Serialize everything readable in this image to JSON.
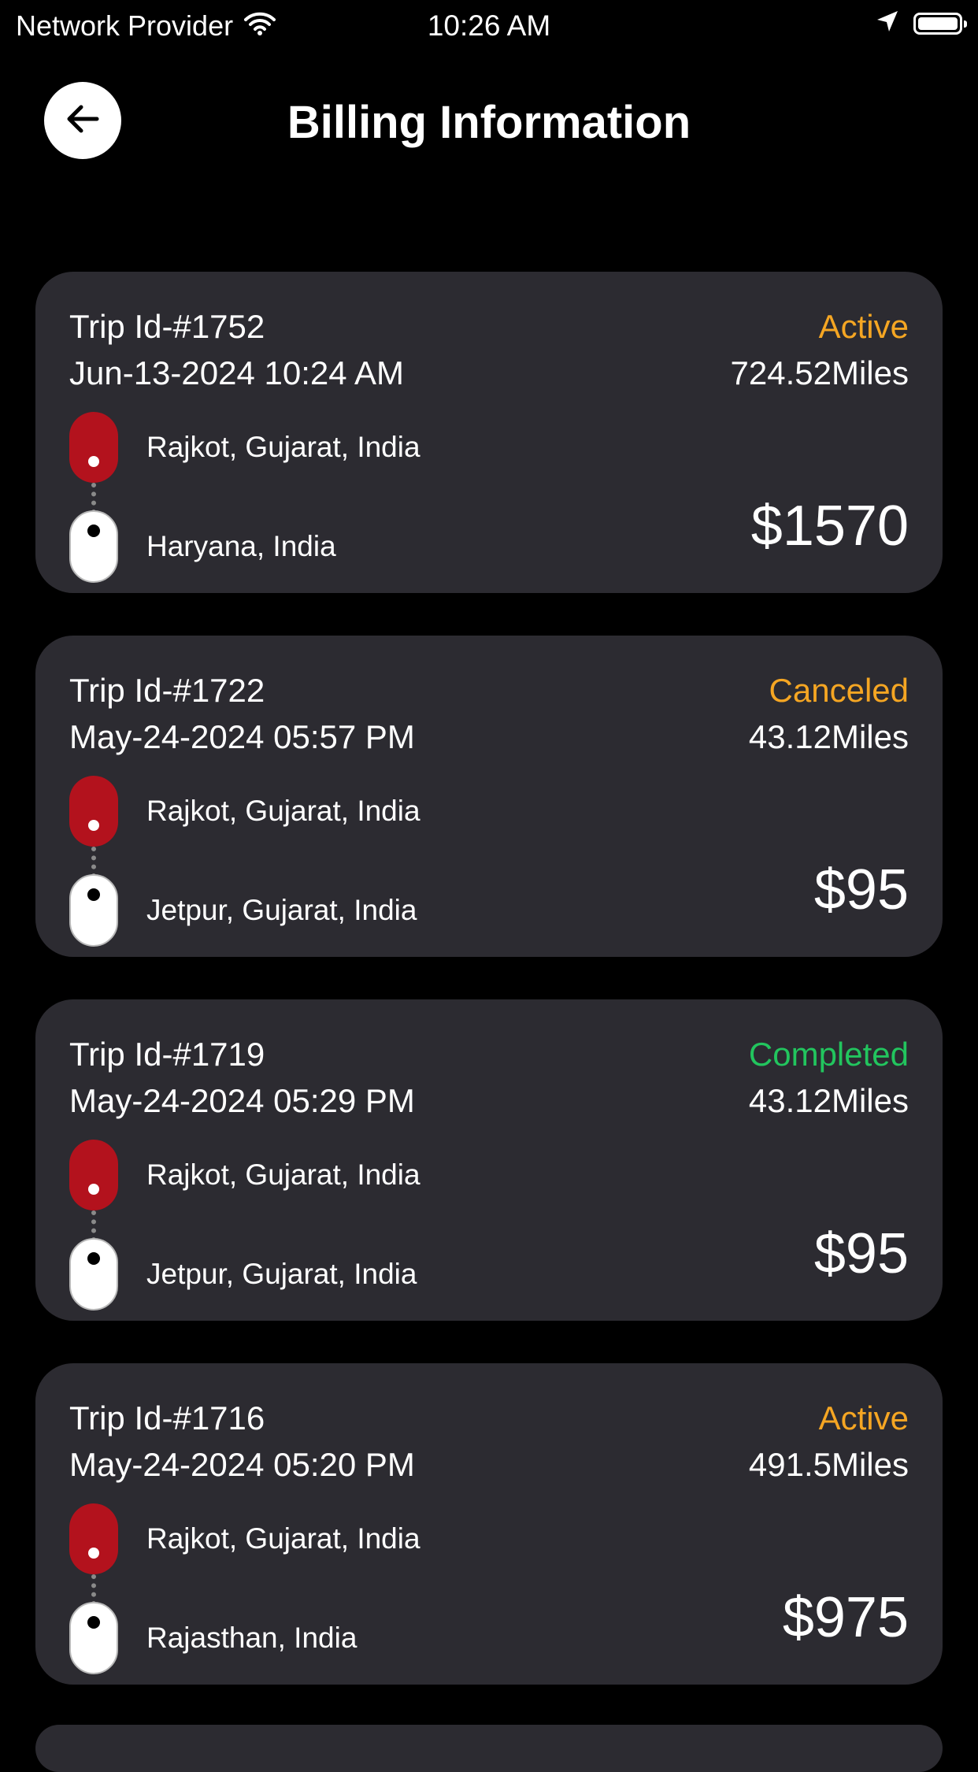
{
  "status_bar": {
    "carrier": "Network Provider",
    "time": "10:26 AM"
  },
  "header": {
    "title": "Billing Information",
    "back_icon": "arrow-left-icon"
  },
  "colors": {
    "background": "#000000",
    "card": "#2c2b31",
    "active": "#f5a623",
    "canceled": "#f5a623",
    "completed": "#22c55e",
    "pickup_pin": "#b3121d"
  },
  "trips": [
    {
      "trip_id": "Trip Id-#1752",
      "datetime": "Jun-13-2024 10:24 AM",
      "status": "Active",
      "miles": "724.52Miles",
      "from": "Rajkot, Gujarat, India",
      "to": "Haryana, India",
      "price": "$1570"
    },
    {
      "trip_id": "Trip Id-#1722",
      "datetime": "May-24-2024 05:57 PM",
      "status": "Canceled",
      "miles": "43.12Miles",
      "from": "Rajkot, Gujarat, India",
      "to": "Jetpur, Gujarat, India",
      "price": "$95"
    },
    {
      "trip_id": "Trip Id-#1719",
      "datetime": "May-24-2024 05:29 PM",
      "status": "Completed",
      "miles": "43.12Miles",
      "from": "Rajkot, Gujarat, India",
      "to": "Jetpur, Gujarat, India",
      "price": "$95"
    },
    {
      "trip_id": "Trip Id-#1716",
      "datetime": "May-24-2024 05:20 PM",
      "status": "Active",
      "miles": "491.5Miles",
      "from": "Rajkot, Gujarat, India",
      "to": "Rajasthan, India",
      "price": "$975"
    }
  ]
}
